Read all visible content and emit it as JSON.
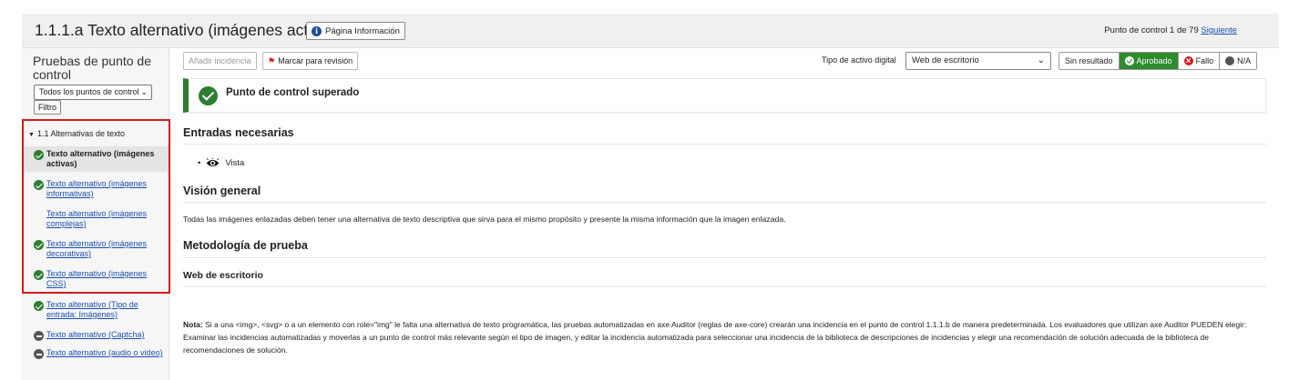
{
  "header": {
    "title": "1.1.1.a Texto alternativo (imágenes activas)",
    "info_button": "Página Información",
    "checkpoint_counter": "Punto de control 1 de 79",
    "next_link": "Siguiente"
  },
  "sidebar": {
    "title": "Pruebas de punto de control",
    "filter_select": "Todos los puntos de control",
    "filter_button": "Filtro",
    "group": "1.1 Alternativas de texto",
    "items": [
      {
        "label": "Texto alternativo (imágenes activas)",
        "status": "pass"
      },
      {
        "label": "Texto alternativo (imágenes informativas)",
        "status": "pass"
      },
      {
        "label": "Texto alternativo (imágenes complejas)",
        "status": "none"
      },
      {
        "label": "Texto alternativo (imágenes decorativas)",
        "status": "pass"
      },
      {
        "label": "Texto alternativo (imágenes CSS)",
        "status": "pass"
      },
      {
        "label": "Texto alternativo (Tipo de entrada: Imágenes)",
        "status": "pass"
      },
      {
        "label": "Texto alternativo (Captcha)",
        "status": "na"
      },
      {
        "label": "Texto alternativo (audio o video)",
        "status": "na"
      }
    ]
  },
  "toolbar": {
    "add_issue": "Añadir incidencia",
    "mark_review": "Marcar para revisión",
    "asset_type_label": "Tipo de activo digital",
    "asset_type_value": "Web de escritorio",
    "results": {
      "none": "Sin resultado",
      "pass": "Aprobado",
      "fail": "Fallo",
      "na": "N/A"
    },
    "selected_result": "pass"
  },
  "main": {
    "status_banner": "Punto de control superado",
    "required_inputs_heading": "Entradas necesarias",
    "required_inputs": [
      "Vista"
    ],
    "overview_heading": "Visión general",
    "overview_text": "Todas las imágenes enlazadas deben tener una alternativa de texto descriptiva que sirva para el mismo propósito y presente la misma información que la imagen enlazada.",
    "methodology_heading": "Metodología de prueba",
    "methodology_sub": "Web de escritorio",
    "note_label": "Nota:",
    "note_text": " Si a una <img>, <svg> o a un elemento con role=\"img\" le falta una alternativa de texto programática, las pruebas automatizadas en axe Auditor (reglas de axe-core) crearán una incidencia en el punto de control 1.1.1.b de manera predeterminada. Los evaluadores que utilizan axe Auditor PUEDEN elegir: Examinar las incidencias automatizadas y moverlas a un punto de control más relevante según el tipo de imagen, y editar la incidencia automatizada para seleccionar una incidencia de la biblioteca de descripciones de incidencias y elegir una recomendación de solución adecuada de la biblioteca de recomendaciones de solución."
  },
  "colors": {
    "pass": "#2e7d32",
    "fail": "#d21a1a",
    "link": "#1a4fb0",
    "highlight": "#d21a1a"
  }
}
